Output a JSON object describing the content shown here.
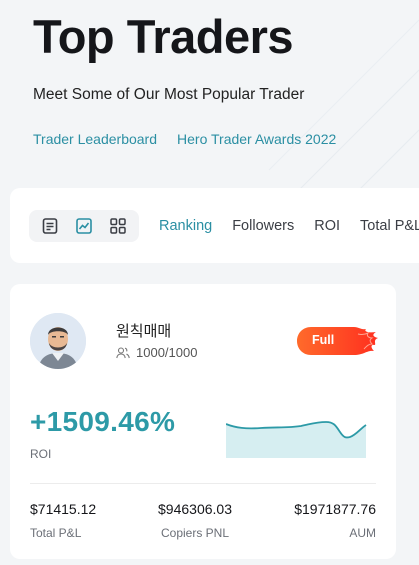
{
  "hero": {
    "title": "Top Traders",
    "subtitle": "Meet Some of Our Most Popular Trader",
    "links": [
      "Trader Leaderboard",
      "Hero Trader Awards 2022"
    ]
  },
  "toolbar": {
    "view_icons": [
      "list-view-icon",
      "chart-view-icon",
      "grid-view-icon"
    ],
    "sort_tabs": [
      "Ranking",
      "Followers",
      "ROI",
      "Total P&L"
    ],
    "active_tab": "Ranking"
  },
  "trader": {
    "name": "원칙매매",
    "followers": "1000/1000",
    "badge": "Full",
    "roi_value": "+1509.46%",
    "roi_label": "ROI",
    "stats": [
      {
        "value": "$71415.12",
        "label": "Total P&L"
      },
      {
        "value": "$946306.03",
        "label": "Copiers PNL"
      },
      {
        "value": "$1971877.76",
        "label": "AUM"
      }
    ]
  },
  "colors": {
    "accent": "#2b8fa3",
    "roi": "#2d9aa7",
    "badge_start": "#ff3b21",
    "badge_end": "#ff7a2a"
  }
}
